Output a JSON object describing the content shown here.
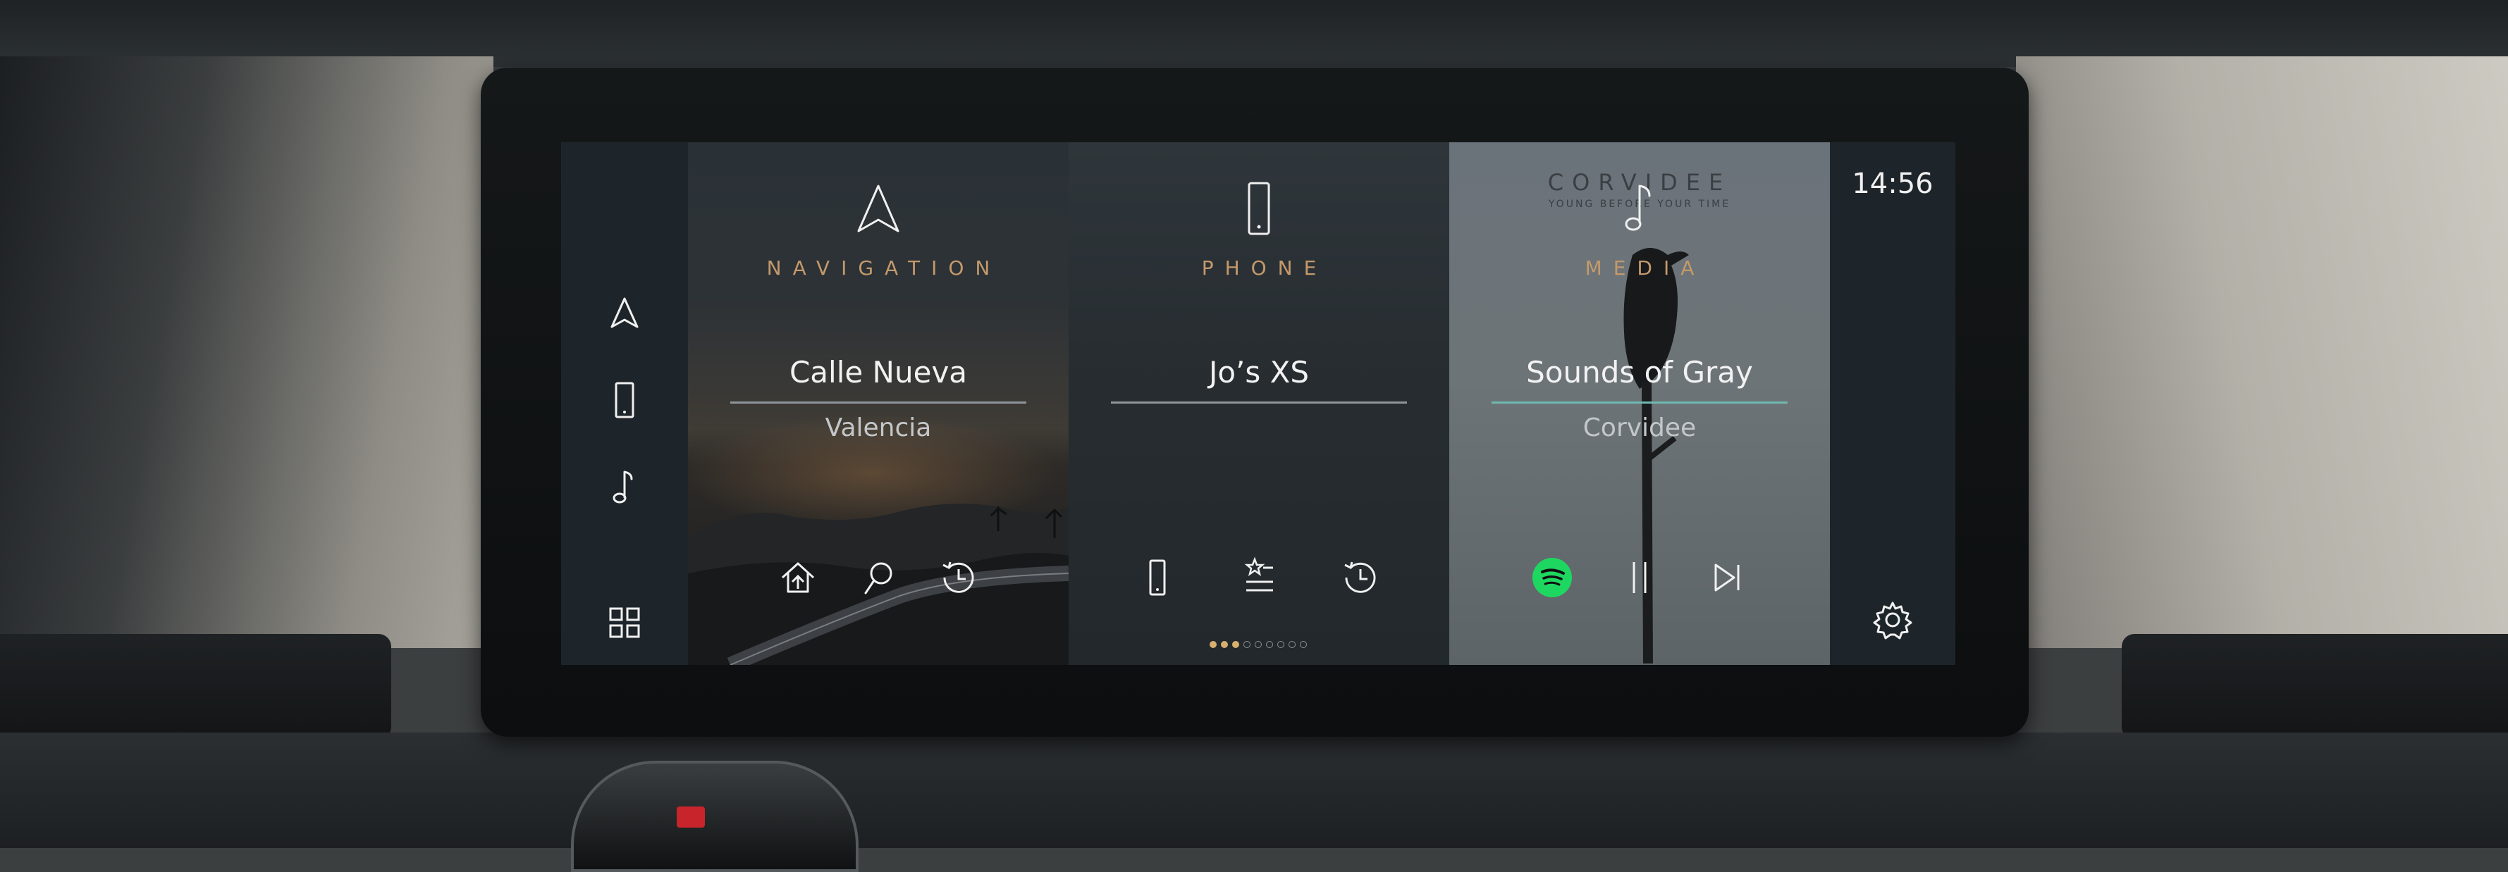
{
  "status_bar": {
    "time": "14:56"
  },
  "left_rail": {
    "items": [
      {
        "icon": "navigation-arrow-icon"
      },
      {
        "icon": "phone-icon"
      },
      {
        "icon": "music-note-icon"
      },
      {
        "icon": "app-grid-icon"
      }
    ]
  },
  "cards": {
    "navigation": {
      "label": "NAVIGATION",
      "title": "Calle Nueva",
      "subtitle": "Valencia",
      "icon": "navigation-arrow-icon",
      "buttons": [
        "home-icon",
        "search-icon",
        "history-icon"
      ]
    },
    "phone": {
      "label": "PHONE",
      "title": "Jo’s XS",
      "icon": "phone-icon",
      "buttons": [
        "phone-icon",
        "favorites-list-icon",
        "history-icon"
      ]
    },
    "media": {
      "label": "MEDIA",
      "title": "Sounds of Gray",
      "subtitle": "Corvidee",
      "icon": "music-note-icon",
      "album_brand": "CORVIDEE",
      "album_tagline": "YOUNG BEFORE YOUR TIME",
      "buttons": [
        "spotify-icon",
        "pause-icon",
        "skip-next-icon"
      ]
    }
  },
  "pager": {
    "total": 9,
    "active_index": 2
  },
  "colors": {
    "accent_label": "#c4996b",
    "accent_line": "#6fb9b0",
    "spotify": "#1ed760",
    "dot_active": "#d8b06e"
  }
}
